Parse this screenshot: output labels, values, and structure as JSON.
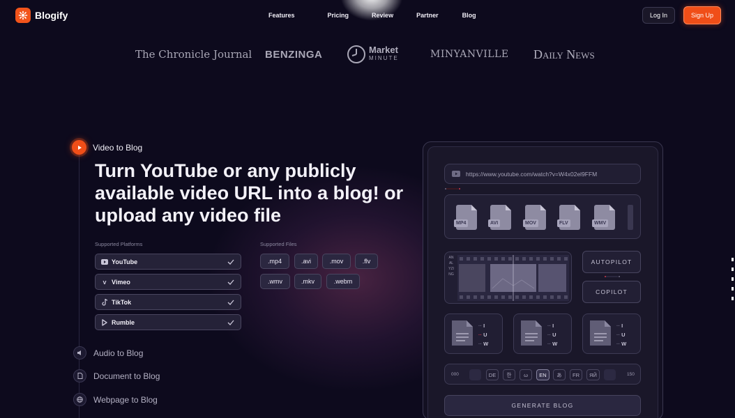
{
  "brand": {
    "name": "Blogify",
    "accent": "#f04e18"
  },
  "nav": {
    "links": [
      "Features",
      "Pricing",
      "Review",
      "Partner",
      "Blog"
    ],
    "login": "Log In",
    "signup": "Sign Up"
  },
  "press": {
    "chronicle": "The Chronicle Journal",
    "benzinga": "BENZINGA",
    "market_top": "Market",
    "market_bottom": "MINUTE",
    "minyanville": "MINYANVILLE",
    "daily_news": "Daily News"
  },
  "feature": {
    "active_label": "Video to Blog",
    "headline": "Turn YouTube or any publicly available video URL into a blog! or upload any video file",
    "platforms_label": "Supported Platforms",
    "files_label": "Supported Files",
    "platforms": [
      "YouTube",
      "Vimeo",
      "TikTok",
      "Rumble"
    ],
    "files": [
      ".mp4",
      ".avi",
      ".mov",
      ".flv",
      ".wmv",
      ".mkv",
      ".webm"
    ],
    "other_features": [
      "Audio to Blog",
      "Document to Blog",
      "Webpage to Blog"
    ]
  },
  "mock": {
    "url": "https://www.youtube.com/watch?v=W4x02el9FFM",
    "file_types": [
      "MP4",
      "AVI",
      "MOV",
      "FLV",
      "WMV"
    ],
    "analyzing": "ANALYZING",
    "autopilot": "AUTOPILOT",
    "copilot": "COPILOT",
    "format_letters": [
      "I",
      "U",
      "W"
    ],
    "lang_start": "000",
    "lang_end": "150",
    "languages": [
      "DE",
      "한",
      "ω",
      "EN",
      "あ",
      "FR",
      "ЯЙ"
    ],
    "generate": "GENERATE BLOG"
  }
}
